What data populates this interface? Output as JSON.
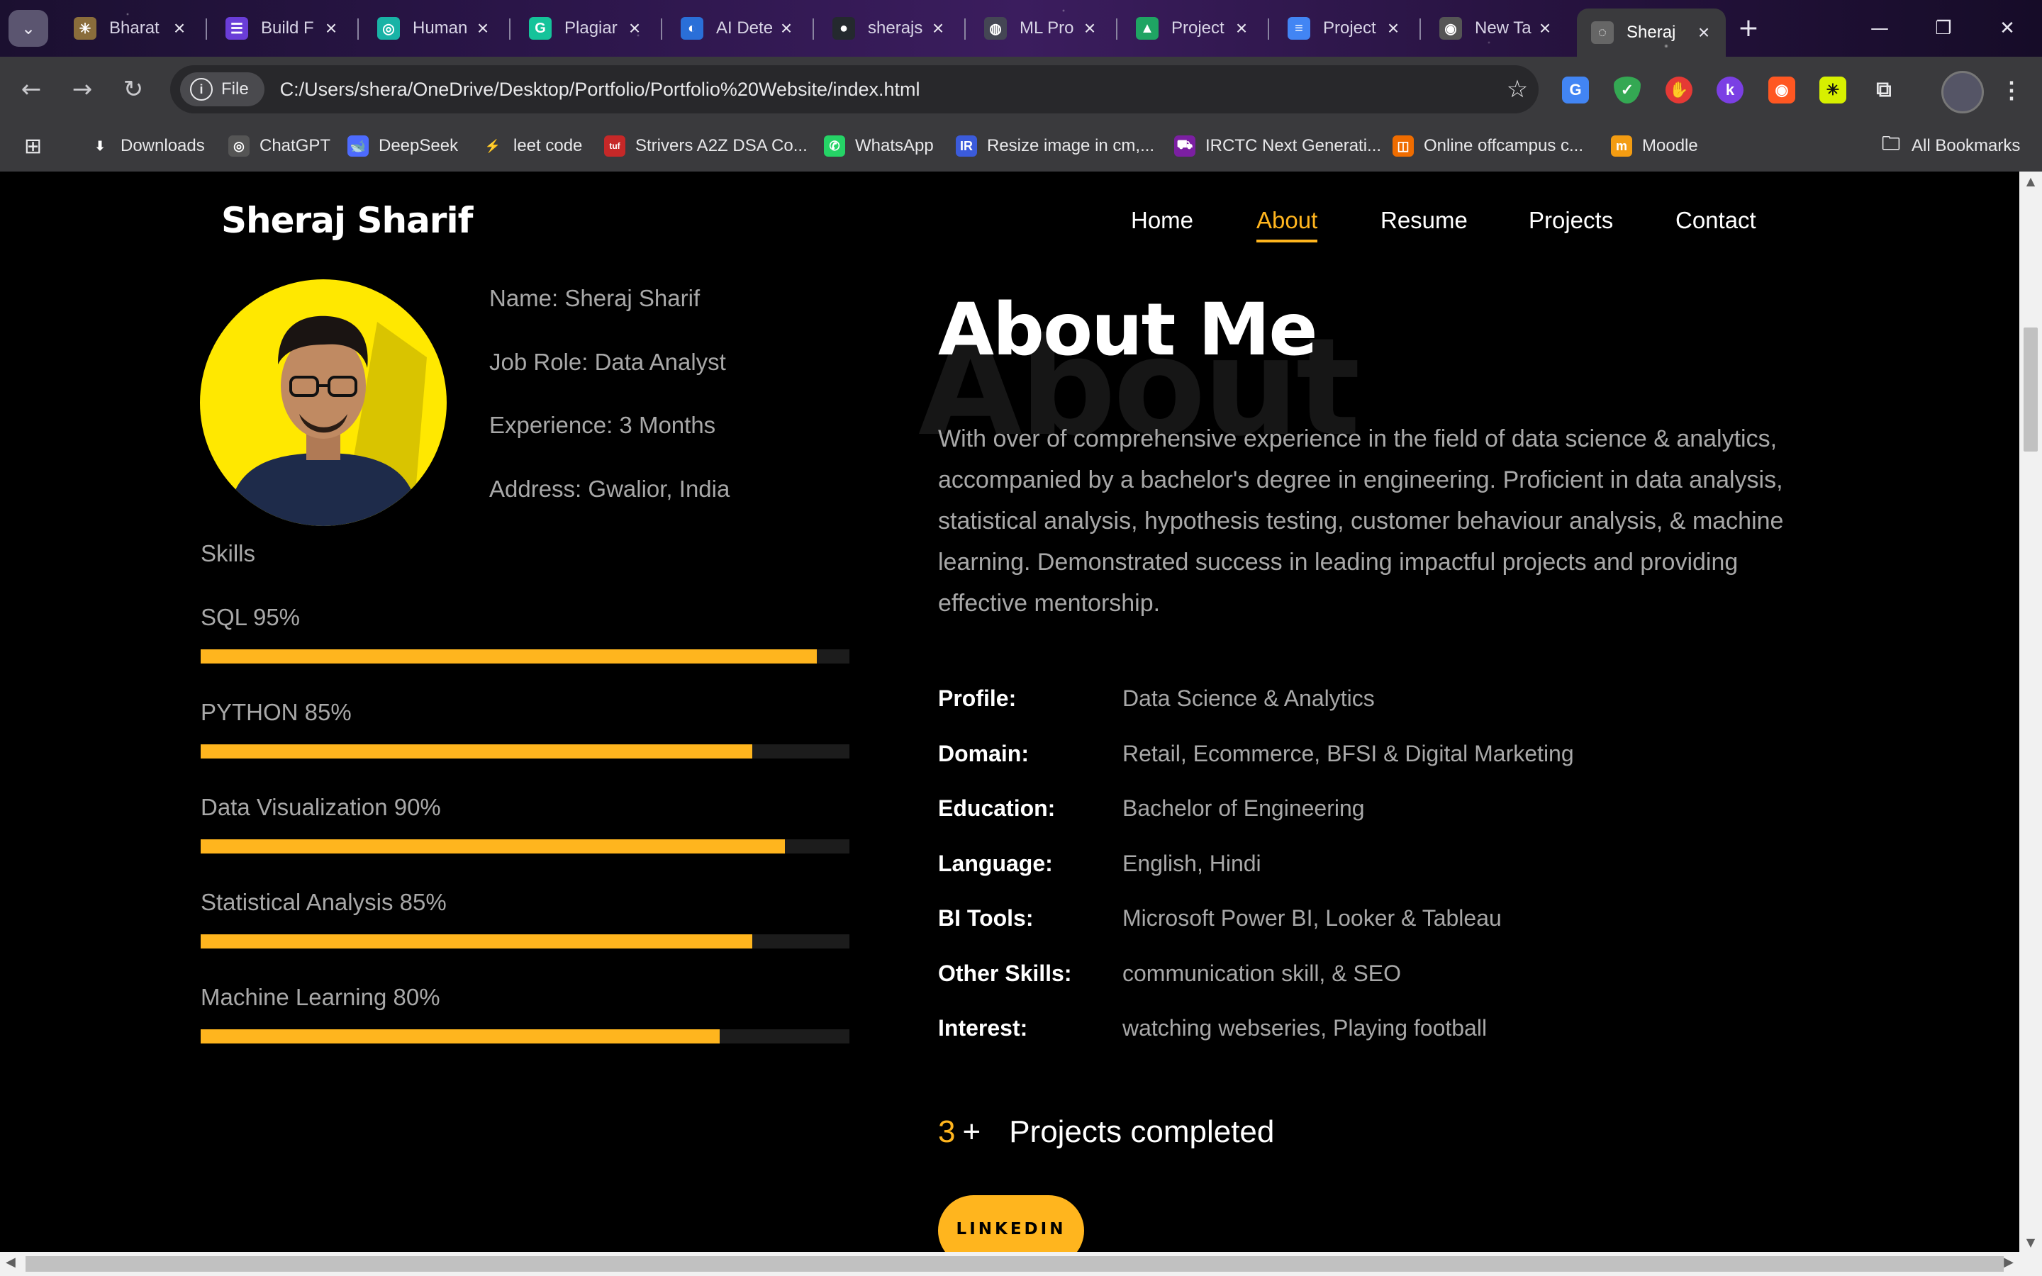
{
  "browser": {
    "tabs": [
      {
        "label": "Bharat",
        "icon": "sparkle-icon",
        "color": "#8a6d3b"
      },
      {
        "label": "Build F",
        "icon": "form-icon",
        "color": "#6a3dd8"
      },
      {
        "label": "Human",
        "icon": "human-icon",
        "color": "#19b3a6"
      },
      {
        "label": "Plagiar",
        "icon": "grammarly-icon",
        "color": "#15c39a"
      },
      {
        "label": "AI Dete",
        "icon": "ai-detector-icon",
        "color": "#2a6fd8"
      },
      {
        "label": "sherajs",
        "icon": "github-icon",
        "color": "#24292e"
      },
      {
        "label": "ML Pro",
        "icon": "openai-icon",
        "color": "#444654"
      },
      {
        "label": "Project",
        "icon": "drive-icon",
        "color": "#1fa463"
      },
      {
        "label": "Project",
        "icon": "docs-icon",
        "color": "#4285f4"
      },
      {
        "label": "New Ta",
        "icon": "chrome-icon",
        "color": "#555555"
      },
      {
        "label": "Sheraj",
        "icon": "globe-icon",
        "color": "#666666",
        "active": true
      }
    ],
    "address": {
      "chip": "File",
      "url": "C:/Users/shera/OneDrive/Desktop/Portfolio/Portfolio%20Website/index.html"
    },
    "bookmarks": [
      {
        "label": "Downloads",
        "icon": "download-icon"
      },
      {
        "label": "ChatGPT",
        "icon": "openai-icon"
      },
      {
        "label": "DeepSeek",
        "icon": "deepseek-icon"
      },
      {
        "label": "leet code",
        "icon": "leetcode-icon"
      },
      {
        "label": "Strivers A2Z DSA Co...",
        "icon": "tuf-icon"
      },
      {
        "label": "WhatsApp",
        "icon": "whatsapp-icon"
      },
      {
        "label": "Resize image in cm,...",
        "icon": "resize-icon"
      },
      {
        "label": "IRCTC Next Generati...",
        "icon": "irctc-icon"
      },
      {
        "label": "Online offcampus c...",
        "icon": "offcampus-icon"
      },
      {
        "label": "Moodle",
        "icon": "moodle-icon"
      }
    ],
    "all_bookmarks": "All Bookmarks"
  },
  "site": {
    "logo": "Sheraj Sharif",
    "nav": [
      "Home",
      "About",
      "Resume",
      "Projects",
      "Contact"
    ],
    "active_nav": "About",
    "accent_color": "#ffb51e"
  },
  "profile": {
    "name": "Name: Sheraj Sharif",
    "job": "Job Role: Data Analyst",
    "experience": "Experience: 3 Months",
    "address": "Address: Gwalior, India"
  },
  "skills": {
    "title": "Skills",
    "items": [
      {
        "label": "SQL 95%",
        "percent": 95
      },
      {
        "label": "PYTHON 85%",
        "percent": 85
      },
      {
        "label": "Data Visualization 90%",
        "percent": 90
      },
      {
        "label": "Statistical Analysis 85%",
        "percent": 85
      },
      {
        "label": "Machine Learning 80%",
        "percent": 80
      }
    ]
  },
  "about": {
    "bg_text": "About",
    "title": "About Me",
    "paragraph": "With over of comprehensive experience in the field of data science & analytics, accompanied by a bachelor's degree in engineering. Proficient in data analysis, statistical analysis, hypothesis testing, customer behaviour analysis, & machine learning. Demonstrated success in leading impactful projects and providing effective mentorship.",
    "details": [
      {
        "key": "Profile:",
        "value": "Data Science & Analytics"
      },
      {
        "key": "Domain:",
        "value": "Retail, Ecommerce, BFSI & Digital Marketing"
      },
      {
        "key": "Education:",
        "value": "Bachelor of Engineering"
      },
      {
        "key": "Language:",
        "value": "English, Hindi"
      },
      {
        "key": "BI Tools:",
        "value": "Microsoft Power BI, Looker & Tableau"
      },
      {
        "key": "Other Skills:",
        "value": "communication skill, & SEO"
      },
      {
        "key": "Interest:",
        "value": "watching webseries, Playing football"
      }
    ],
    "counter_num": "3",
    "counter_plus": "+",
    "counter_label": "Projects completed",
    "linkedin": "LINKEDIN"
  }
}
